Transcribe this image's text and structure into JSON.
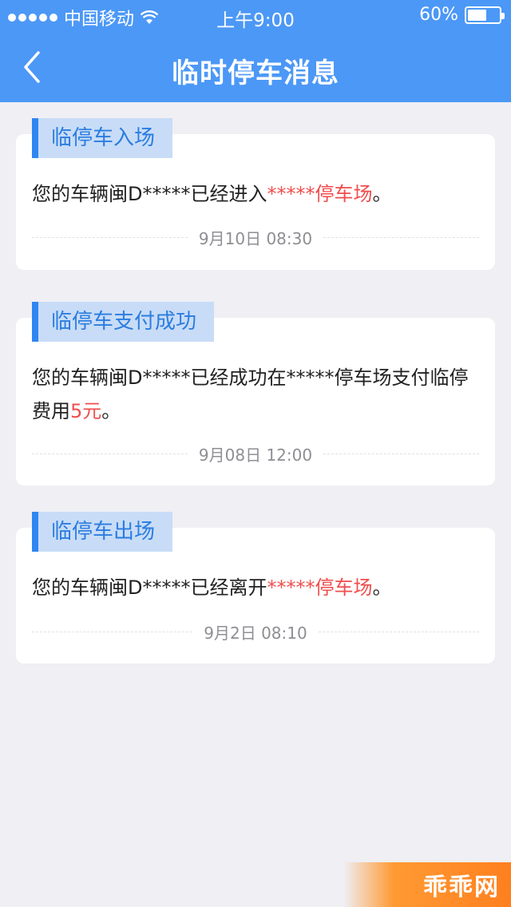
{
  "status_bar": {
    "carrier": "中国移动",
    "time": "上午9:00",
    "battery": "60%",
    "battery_level": 0.6
  },
  "nav": {
    "title": "临时停车消息",
    "back_icon": "chevron-left-icon"
  },
  "messages": [
    {
      "tag": "临停车入场",
      "text_plain": "您的车辆闽D*****已经进入",
      "text_highlight": "*****停车场",
      "text_tail": "。",
      "time": "9月10日 08:30"
    },
    {
      "tag": "临停车支付成功",
      "text_plain": "您的车辆闽D*****已经成功在*****停车场支付临停费用",
      "text_highlight": "5元",
      "text_tail": "。",
      "time": "9月08日 12:00"
    },
    {
      "tag": "临停车出场",
      "text_plain": "您的车辆闽D*****已经离开",
      "text_highlight": "*****停车场",
      "text_tail": "。",
      "time": "9月2日 08:10"
    }
  ],
  "watermark": "乖乖网",
  "colors": {
    "nav_bg": "#4c98f6",
    "tag_bg": "#c8dcf7",
    "tag_accent": "#2f86f2",
    "highlight": "#f04e4e",
    "page_bg": "#efeff4"
  }
}
